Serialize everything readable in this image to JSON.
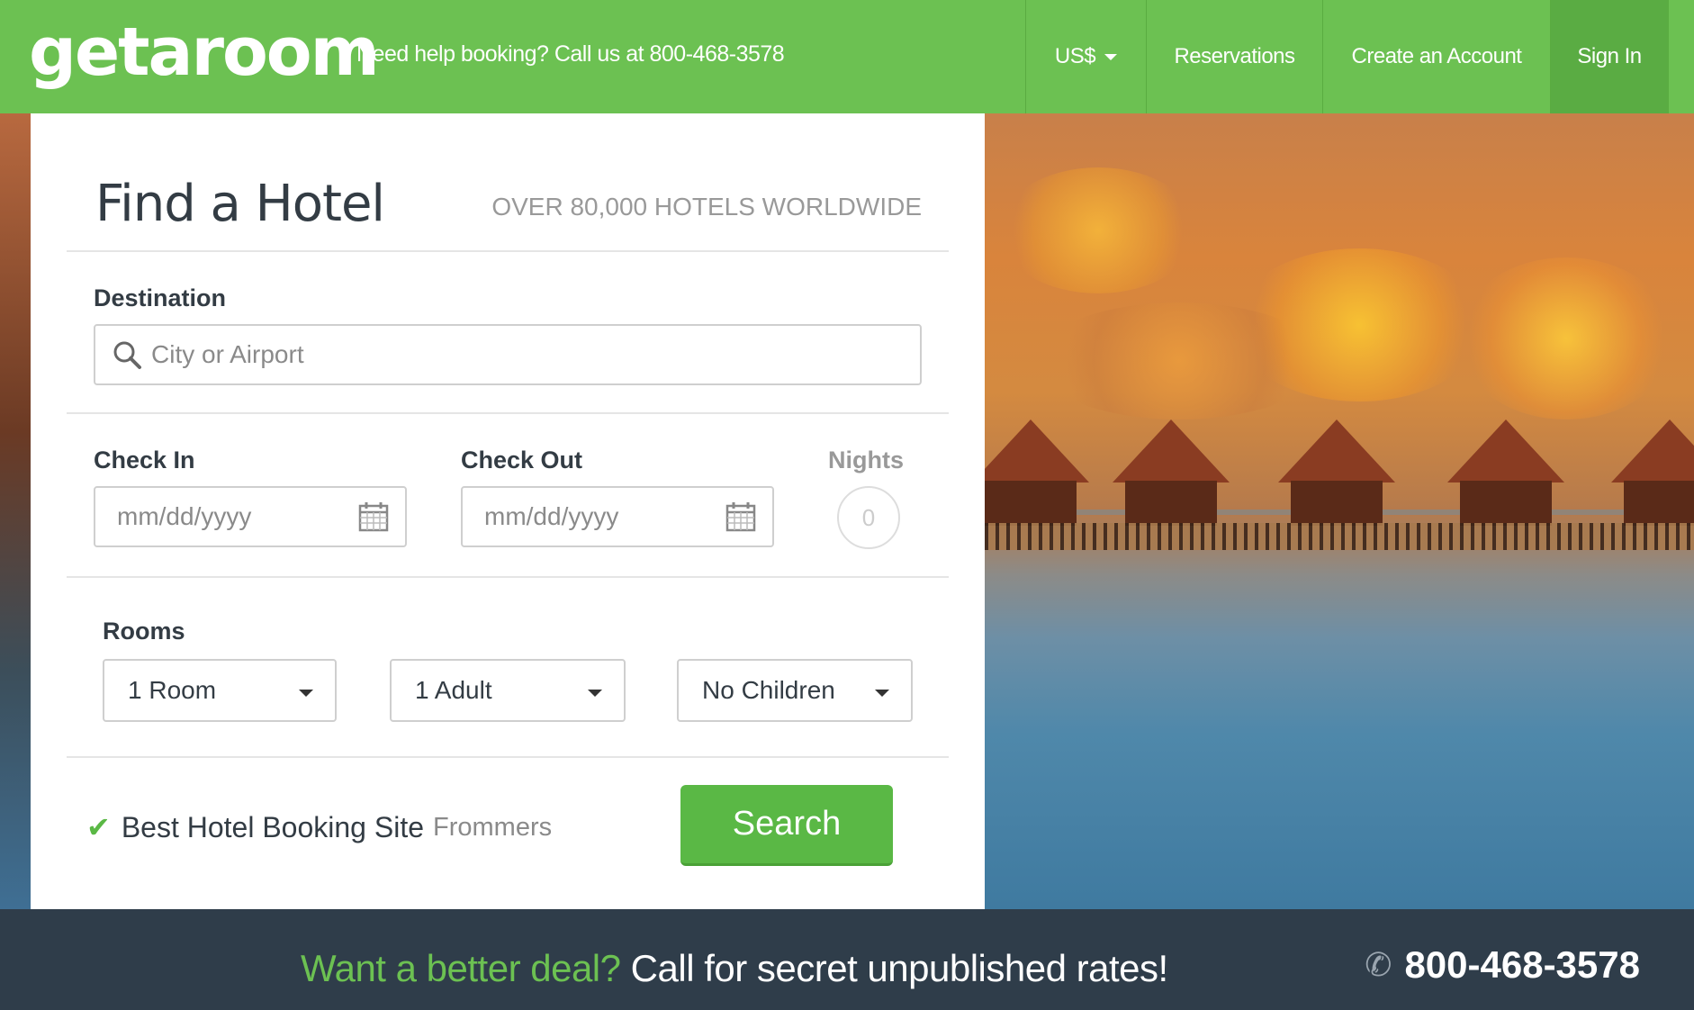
{
  "header": {
    "logo": "getaroom",
    "help_text": "Need help booking? Call us at 800-468-3578",
    "nav": {
      "currency": "US$",
      "reservations": "Reservations",
      "create_account": "Create an Account",
      "sign_in": "Sign In"
    }
  },
  "form": {
    "title": "Find a Hotel",
    "tagline": "OVER 80,000 HOTELS WORLDWIDE",
    "destination": {
      "label": "Destination",
      "placeholder": "City or Airport"
    },
    "check_in": {
      "label": "Check In",
      "placeholder": "mm/dd/yyyy"
    },
    "check_out": {
      "label": "Check Out",
      "placeholder": "mm/dd/yyyy"
    },
    "nights": {
      "label": "Nights",
      "value": "0"
    },
    "rooms": {
      "label": "Rooms",
      "rooms_value": "1 Room",
      "adults_value": "1 Adult",
      "children_value": "No Children"
    },
    "badge": {
      "text": "Best Hotel Booking Site",
      "source": "Frommers"
    },
    "search_label": "Search"
  },
  "footer": {
    "promo_highlight": "Want a better deal?",
    "promo_text": "Call for secret unpublished rates!",
    "phone": "800-468-3578"
  },
  "colors": {
    "brand_green": "#6cc152",
    "button_green": "#5ab845",
    "footer_bg": "#2f3d4a"
  },
  "icons": [
    "search-icon",
    "calendar-icon",
    "chevron-down-icon",
    "check-icon",
    "phone-icon"
  ]
}
